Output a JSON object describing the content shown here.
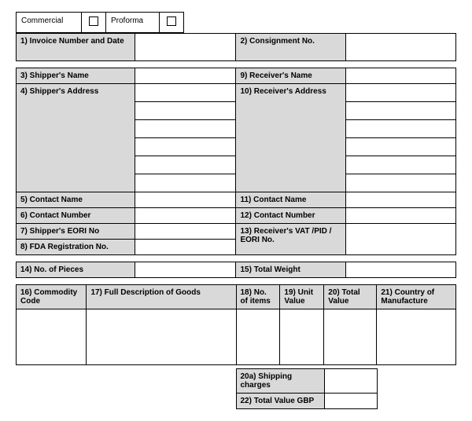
{
  "type": {
    "commercial": "Commercial",
    "proforma": "Proforma"
  },
  "f1": "1) Invoice Number and Date",
  "f2": "2) Consignment No.",
  "f3": "3) Shipper's Name",
  "f4": "4) Shipper's Address",
  "f5": "5) Contact Name",
  "f6": "6) Contact Number",
  "f7": "7) Shipper's EORI No",
  "f8": "8) FDA Registration No.",
  "f9": "9) Receiver's Name",
  "f10": "10) Receiver's Address",
  "f11": "11) Contact Name",
  "f12": "12) Contact Number",
  "f13": "13) Receiver's VAT /PID / EORI No.",
  "f14": "14) No. of Pieces",
  "f15": "15) Total Weight",
  "f16": "16) Commodity Code",
  "f17": "17) Full Description of Goods",
  "f18": "18) No. of items",
  "f19": "19) Unit Value",
  "f20": "20) Total Value",
  "f20a": "20a) Shipping charges",
  "f21": "21) Country of Manufacture",
  "f22": "22) Total Value GBP"
}
